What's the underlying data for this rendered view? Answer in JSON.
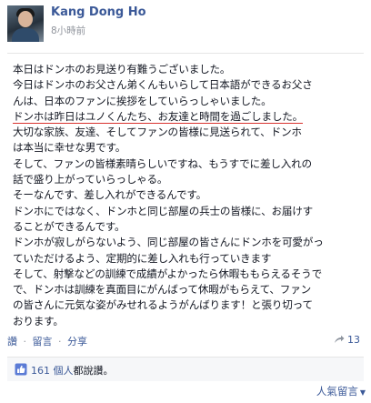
{
  "post": {
    "author": "Kang Dong Ho",
    "timestamp": "8小時前",
    "message_lines": [
      "本日はドンホのお見送り有難うございました。",
      "今日はドンホのお父さん弟くんもいらして日本語ができるお父さ",
      "んは、日本のファンに挨拶をしていらっしゃいました。",
      "ドンホは昨日はユノくんたち、お友達と時間を過ごしました。",
      "大切な家族、友達、そしてファンの皆様に見送られて、ドンホ",
      "は本当に幸せな男です。",
      "そして、ファンの皆様素晴らしいですね、もうすでに差し入れの",
      "話で盛り上がっていらっしゃる。",
      "そーなんです、差し入れができるんです。",
      "ドンホにではなく、ドンホと同じ部屋の兵士の皆様に、お届けす",
      "ることができるんです。",
      "ドンホが寂しがらないよう、同じ部屋の皆さんにドンホを可愛がっ",
      "ていただけるよう、定期的に差し入れも行っていきます",
      "そして、射撃などの訓練で成績がよかったら休暇ももらえるそうで",
      "で、ドンホは訓練を真面目にがんばって休暇がもらえて、ファン",
      "の皆さんに元気な姿がみせれるようがんばります！と張り切って",
      "おります。"
    ]
  },
  "actions": {
    "like": "讚",
    "comment": "留言",
    "share": "分享",
    "separator": "·",
    "share_count": "13"
  },
  "likes": {
    "count": "161 個人",
    "suffix": "都說讚。"
  },
  "comments": {
    "sort_label": "人氣留言"
  },
  "icons": {
    "globe": "globe-icon",
    "share": "share-icon",
    "like": "thumbs-up-icon",
    "chevron": "chevron-down-icon"
  },
  "colors": {
    "link": "#3b5998",
    "underline": "#d8322e"
  }
}
